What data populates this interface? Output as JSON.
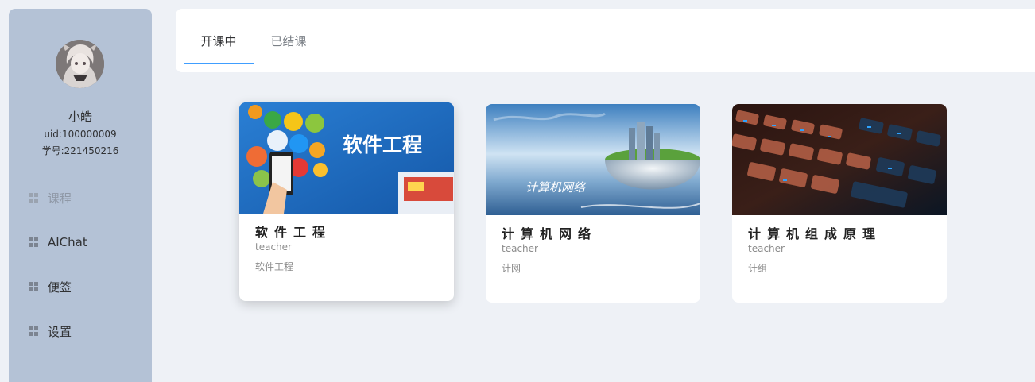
{
  "user": {
    "name": "小皓",
    "uid": "uid:100000009",
    "student_id": "学号:221450216"
  },
  "menu": [
    {
      "label": "课程",
      "icon": "grid-icon",
      "active": true
    },
    {
      "label": "AIChat",
      "icon": "grid-icon"
    },
    {
      "label": "便签",
      "icon": "grid-icon"
    },
    {
      "label": "设置",
      "icon": "grid-icon"
    }
  ],
  "tabs": [
    {
      "label": "开课中",
      "active": true
    },
    {
      "label": "已结课"
    }
  ],
  "courses": [
    {
      "banner_text": "软件工程",
      "title": "软件工程",
      "teacher": "teacher",
      "description": "软件工程"
    },
    {
      "banner_text": "计算机网络",
      "title": "计算机网络",
      "teacher": "teacher",
      "description": "计网"
    },
    {
      "title": "计算机组成原理",
      "teacher": "teacher",
      "description": "计组"
    }
  ],
  "colors": {
    "sidebar_bg": "#b4c2d6",
    "page_bg": "#eef1f6",
    "accent": "#409eff"
  }
}
